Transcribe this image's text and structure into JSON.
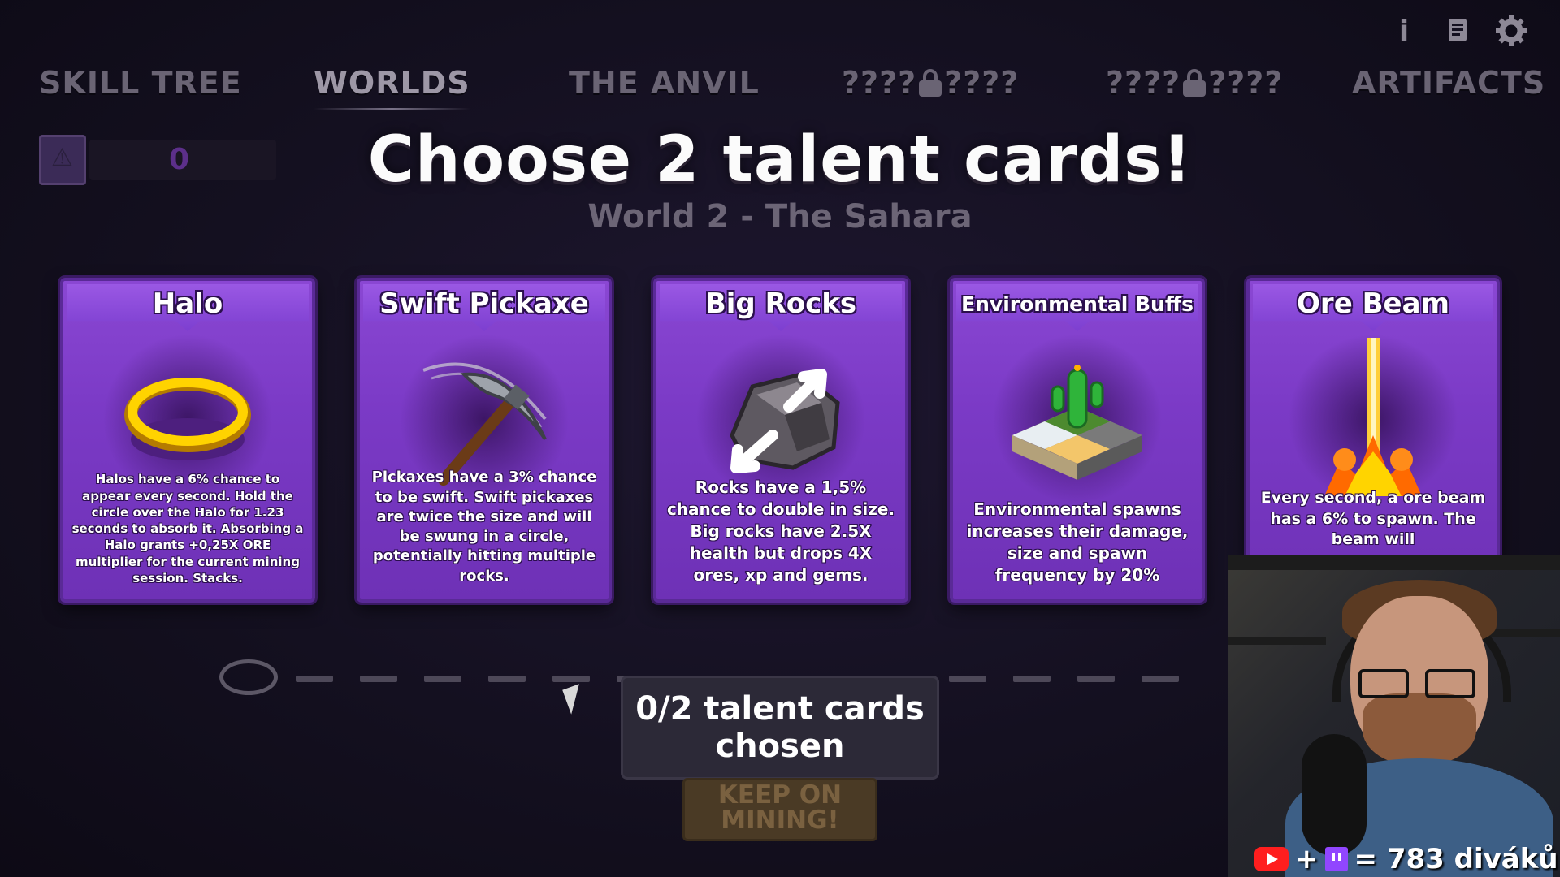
{
  "nav": {
    "tabs": [
      {
        "label": "SKILL TREE"
      },
      {
        "label": "WORLDS"
      },
      {
        "label": "THE ANVIL"
      },
      {
        "left": "????",
        "right": "????"
      },
      {
        "left": "????",
        "right": "????"
      },
      {
        "label": "ARTIFACTS"
      }
    ],
    "active_tab": "WORLDS",
    "icons": [
      "info-icon",
      "scroll-icon",
      "gear-icon"
    ],
    "info_glyph": "i"
  },
  "currency": {
    "value": "0",
    "icon": "rune-book-icon"
  },
  "headline": "Choose 2 talent cards!",
  "world": "World 2 - The Sahara",
  "cards": [
    {
      "title": "Halo",
      "icon": "golden-ring-icon",
      "desc": "Halos have a 6% chance to appear every second. Hold the circle over the Halo for 1.23 seconds to absorb it. Absorbing a Halo grants +0,25X ORE multiplier for the current mining session. Stacks."
    },
    {
      "title": "Swift Pickaxe",
      "icon": "pickaxe-icon",
      "desc": "Pickaxes have a 3% chance to be swift. Swift pickaxes are twice the size and will be swung in a circle, potentially hitting multiple rocks."
    },
    {
      "title": "Big Rocks",
      "icon": "big-rock-icon",
      "desc": "Rocks have a 1,5% chance to double in size. Big rocks have 2.5X health but drops 4X ores, xp and gems."
    },
    {
      "title": "Environmental Buffs",
      "icon": "cactus-tiles-icon",
      "desc": "Environmental spawns increases their damage, size and spawn frequency by 20%"
    },
    {
      "title": "Ore Beam",
      "icon": "ore-beam-icon",
      "desc": "Every second, a ore beam has a 6% to spawn. The beam will"
    }
  ],
  "status": {
    "line1": "0/2 talent cards",
    "line2": "chosen"
  },
  "keep_button": {
    "line1": "KEEP ON",
    "line2": "MINING!"
  },
  "overlay": {
    "viewers_text": "= 783 diváků",
    "plus": "+"
  },
  "colors": {
    "card_purple": "#7b3ac6",
    "background": "#141020",
    "status_box": "#2c2937"
  }
}
